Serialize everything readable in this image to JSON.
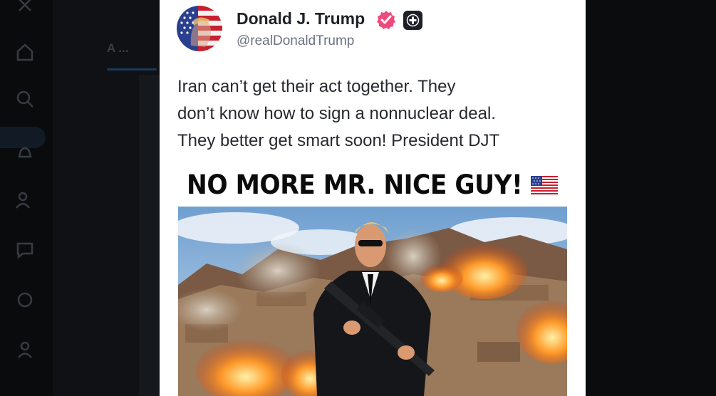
{
  "post": {
    "author": {
      "display_name": "Donald J. Trump",
      "handle": "@realDonaldTrump",
      "avatar_icon": "flag-portrait-avatar",
      "verified_icon": "verified-badge-icon",
      "verified_color": "#ee4b7c",
      "plus_icon": "plus-badge-icon"
    },
    "text_lines": [
      "Iran can’t get their act together. They",
      "don’t know how to sign a nonnuclear deal.",
      "They better get smart soon! President DJT"
    ],
    "media": {
      "headline": "NO MORE MR. NICE GUY!",
      "headline_emoji": "us-flag-icon",
      "image_icon": "armed-man-explosions-image"
    }
  },
  "background": {
    "tab_label": "A ...",
    "sidebar_icons": [
      "close-icon",
      "home-icon",
      "search-icon",
      "notifications-icon",
      "people-icon",
      "chat-icon",
      "groups-icon",
      "profile-icon"
    ]
  }
}
